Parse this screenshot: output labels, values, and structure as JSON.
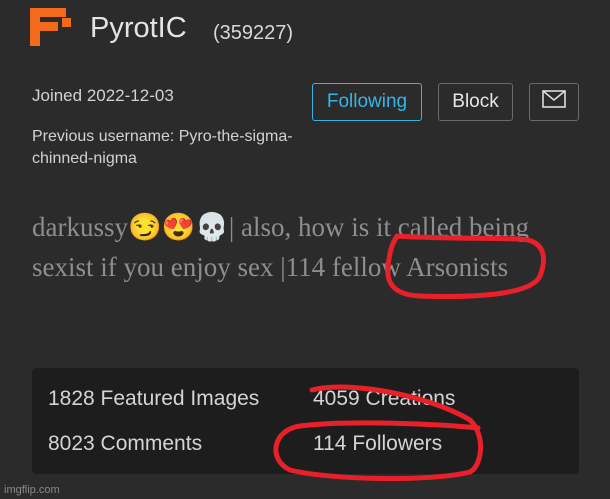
{
  "profile": {
    "username": "PyrotIC",
    "user_id": "(359227)",
    "joined": "Joined 2022-12-03",
    "previous_username": "Previous username: Pyro-the-sigma-chinned-nigma",
    "bio": "darkussy😏😍💀| also, how is it called being sexist if you enjoy sex |114 fellow Arsonists"
  },
  "actions": {
    "follow_label": "Following",
    "block_label": "Block",
    "message_icon": "envelope-icon"
  },
  "stats": {
    "featured_images": "1828 Featured Images",
    "creations": "4059 Creations",
    "comments": "8023 Comments",
    "followers": "114 Followers"
  },
  "watermark": "imgflip.com",
  "colors": {
    "background": "#2b2b2c",
    "stats_background": "#1d1d1e",
    "accent": "#35b5e4",
    "logo": "#f26a1b",
    "annotation": "#e8202a"
  }
}
